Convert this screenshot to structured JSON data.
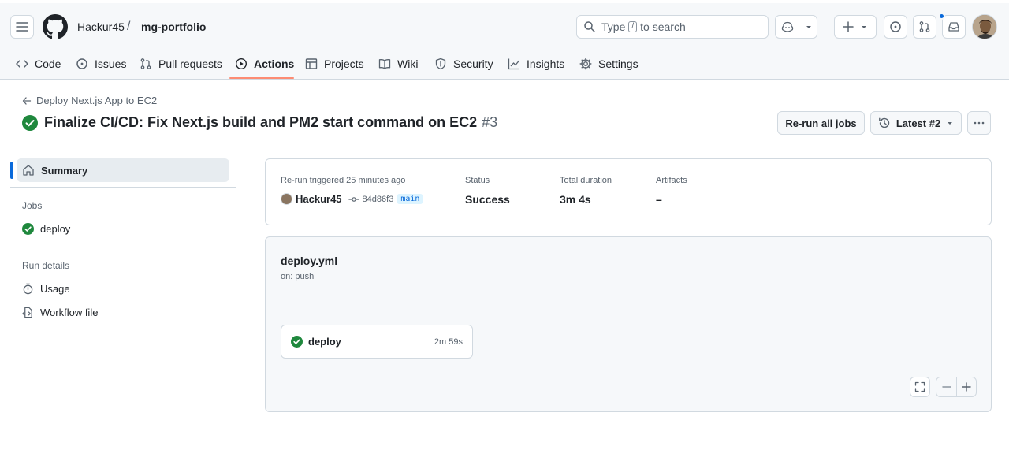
{
  "header": {
    "owner": "Hackur45",
    "separator": "/",
    "repo": "mg-portfolio",
    "search": {
      "before": "Type",
      "key": "/",
      "after": "to search"
    }
  },
  "tabs": [
    {
      "label": "Code",
      "icon": "code-icon"
    },
    {
      "label": "Issues",
      "icon": "issue-icon"
    },
    {
      "label": "Pull requests",
      "icon": "pull-request-icon"
    },
    {
      "label": "Actions",
      "icon": "play-icon",
      "active": true
    },
    {
      "label": "Projects",
      "icon": "table-icon"
    },
    {
      "label": "Wiki",
      "icon": "book-icon"
    },
    {
      "label": "Security",
      "icon": "shield-icon"
    },
    {
      "label": "Insights",
      "icon": "graph-icon"
    },
    {
      "label": "Settings",
      "icon": "gear-icon"
    }
  ],
  "run": {
    "back_label": "Deploy Next.js App to EC2",
    "title": "Finalize CI/CD: Fix Next.js build and PM2 start command on EC2",
    "number": "#3",
    "rerun_label": "Re-run all jobs",
    "latest_label": "Latest #2"
  },
  "sidebar": {
    "summary": "Summary",
    "jobs_heading": "Jobs",
    "jobs": [
      "deploy"
    ],
    "run_details_heading": "Run details",
    "usage": "Usage",
    "workflow_file": "Workflow file"
  },
  "summary": {
    "trigger_label": "Re-run triggered 25 minutes ago",
    "actor": "Hackur45",
    "commit": "84d86f3",
    "branch": "main",
    "status_label": "Status",
    "status_value": "Success",
    "duration_label": "Total duration",
    "duration_value": "3m 4s",
    "artifacts_label": "Artifacts",
    "artifacts_value": "–"
  },
  "graph": {
    "workflow_name": "deploy.yml",
    "trigger": "on: push",
    "job_name": "deploy",
    "job_duration": "2m 59s"
  },
  "colors": {
    "success": "#1f883d",
    "accent": "#0969da",
    "tab_underline": "#fd8c73"
  }
}
